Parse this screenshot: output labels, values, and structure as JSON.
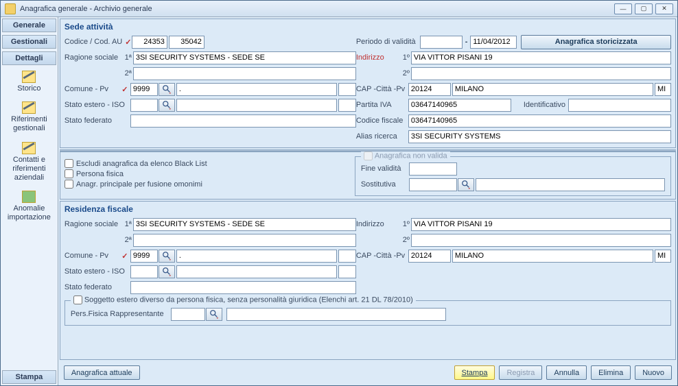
{
  "window": {
    "title": "Anagrafica generale - Archivio generale"
  },
  "sidebar": {
    "generale": "Generale",
    "gestionali": "Gestionali",
    "dettagli": "Dettagli",
    "storico": "Storico",
    "riferimenti": "Riferimenti gestionali",
    "contatti": "Contatti e riferimenti aziendali",
    "anomalie": "Anomalie importazione",
    "stampa": "Stampa"
  },
  "sede": {
    "title": "Sede attività",
    "codice_lbl": "Codice / Cod. AU",
    "codice": "24353",
    "cod_au": "35042",
    "periodo_lbl": "Periodo di validità",
    "periodo_from": "",
    "periodo_sep": "-",
    "periodo_to": "11/04/2012",
    "storicizzata_btn": "Anagrafica storicizzata",
    "ragione_lbl": "Ragione sociale",
    "sup1": "1ª",
    "ragione1": "3SI SECURITY SYSTEMS - SEDE SE",
    "sup2": "2ª",
    "ragione2": "",
    "indirizzo_lbl": "Indirizzo",
    "ind_sup1": "1º",
    "indirizzo1": "VIA VITTOR PISANI 19",
    "ind_sup2": "2º",
    "indirizzo2": "",
    "comune_lbl": "Comune - Pv",
    "comune_code": "9999",
    "comune_desc": ".",
    "comune_extra": "",
    "cap_lbl": "CAP -Città -Pv",
    "cap": "20124",
    "citta": "MILANO",
    "pv": "MI",
    "stato_lbl": "Stato estero - ISO",
    "stato_code": "",
    "stato_desc": "",
    "stato_extra": "",
    "piva_lbl": "Partita IVA",
    "piva": "03647140965",
    "ident_lbl": "Identificativo",
    "ident": "",
    "fed_lbl": "Stato federato",
    "fed": "",
    "cf_lbl": "Codice fiscale",
    "cf": "03647140965",
    "alias_lbl": "Alias ricerca",
    "alias": "3SI SECURITY SYSTEMS"
  },
  "opts": {
    "escludi": "Escludi anagrafica da elenco Black List",
    "persona": "Persona fisica",
    "principale": "Anagr. principale per fusione omonimi",
    "nonvalida_title": "Anagrafica non valida",
    "fine_lbl": "Fine validità",
    "fine": "",
    "sost_lbl": "Sostitutiva",
    "sost_code": "",
    "sost_desc": ""
  },
  "res": {
    "title": "Residenza fiscale",
    "ragione_lbl": "Ragione sociale",
    "sup1": "1ª",
    "ragione1": "3SI SECURITY SYSTEMS - SEDE SE",
    "sup2": "2ª",
    "ragione2": "",
    "indirizzo_lbl": "Indirizzo",
    "ind_sup1": "1º",
    "indirizzo1": "VIA VITTOR PISANI 19",
    "ind_sup2": "2º",
    "indirizzo2": "",
    "comune_lbl": "Comune - Pv",
    "comune_code": "9999",
    "comune_desc": ".",
    "comune_extra": "",
    "cap_lbl": "CAP -Città -Pv",
    "cap": "20124",
    "citta": "MILANO",
    "pv": "MI",
    "stato_lbl": "Stato estero - ISO",
    "stato_code": "",
    "stato_desc": "",
    "stato_extra": "",
    "fed_lbl": "Stato federato",
    "fed": "",
    "group_title": "Soggetto estero diverso da persona fisica, senza personalità giuridica (Elenchi art. 21 DL 78/2010)",
    "rapp_lbl": "Pers.Fisica Rappresentante",
    "rapp_code": "",
    "rapp_desc": ""
  },
  "footer": {
    "attuale": "Anagrafica attuale",
    "stampa": "Stampa",
    "registra": "Registra",
    "annulla": "Annulla",
    "elimina": "Elimina",
    "nuovo": "Nuovo"
  }
}
